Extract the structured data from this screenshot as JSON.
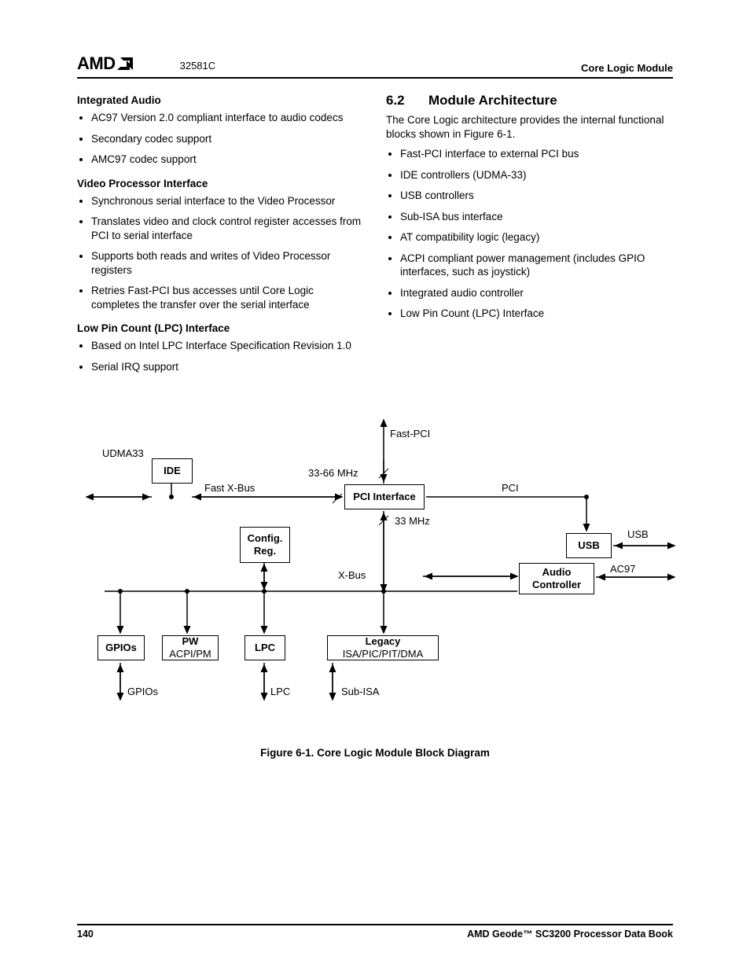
{
  "header": {
    "logo": "AMD",
    "docnum": "32581C",
    "module": "Core Logic Module"
  },
  "left": {
    "h1": "Integrated Audio",
    "b1": [
      "AC97 Version 2.0 compliant interface to audio codecs",
      "Secondary codec support",
      "AMC97 codec support"
    ],
    "h2": "Video Processor Interface",
    "b2": [
      "Synchronous serial interface to the Video Processor",
      "Translates video and clock control register accesses from PCI to serial interface",
      "Supports both reads and writes of Video Processor registers",
      "Retries Fast-PCI bus accesses until Core Logic completes the transfer over the serial interface"
    ],
    "h3": "Low Pin Count (LPC) Interface",
    "b3": [
      "Based on Intel LPC Interface Specification Revision 1.0",
      "Serial IRQ support"
    ]
  },
  "right": {
    "secnum": "6.2",
    "sectitle": "Module Architecture",
    "intro": "The Core Logic architecture provides the internal functional blocks shown in Figure 6-1.",
    "b": [
      "Fast-PCI interface to external PCI bus",
      "IDE controllers (UDMA-33)",
      "USB controllers",
      "Sub-ISA bus interface",
      "AT compatibility logic (legacy)",
      "ACPI compliant power management (includes GPIO interfaces, such as joystick)",
      "Integrated audio controller",
      "Low Pin Count (LPC) Interface"
    ]
  },
  "diagram": {
    "caption": "Figure 6-1.  Core Logic Module Block Diagram",
    "boxes": {
      "ide": "IDE",
      "config1": "Config.",
      "config2": "Reg.",
      "pci": "PCI Interface",
      "usb": "USB",
      "audio1": "Audio",
      "audio2": "Controller",
      "gpios": "GPIOs",
      "pw1": "PW",
      "pw2": "ACPI/PM",
      "lpc": "LPC",
      "legacy1": "Legacy",
      "legacy2": "ISA/PIC/PIT/DMA"
    },
    "labels": {
      "udma33": "UDMA33",
      "fastpci": "Fast-PCI",
      "fastxbus": "Fast X-Bus",
      "mhz1": "33-66 MHz",
      "mhz2": "33 MHz",
      "pci": "PCI",
      "usb_ext": "USB",
      "ac97": "AC97",
      "xbus": "X-Bus",
      "gpios_ext": "GPIOs",
      "lpc_ext": "LPC",
      "subisa": "Sub-ISA"
    }
  },
  "footer": {
    "page": "140",
    "book": "AMD Geode™ SC3200 Processor Data Book"
  }
}
